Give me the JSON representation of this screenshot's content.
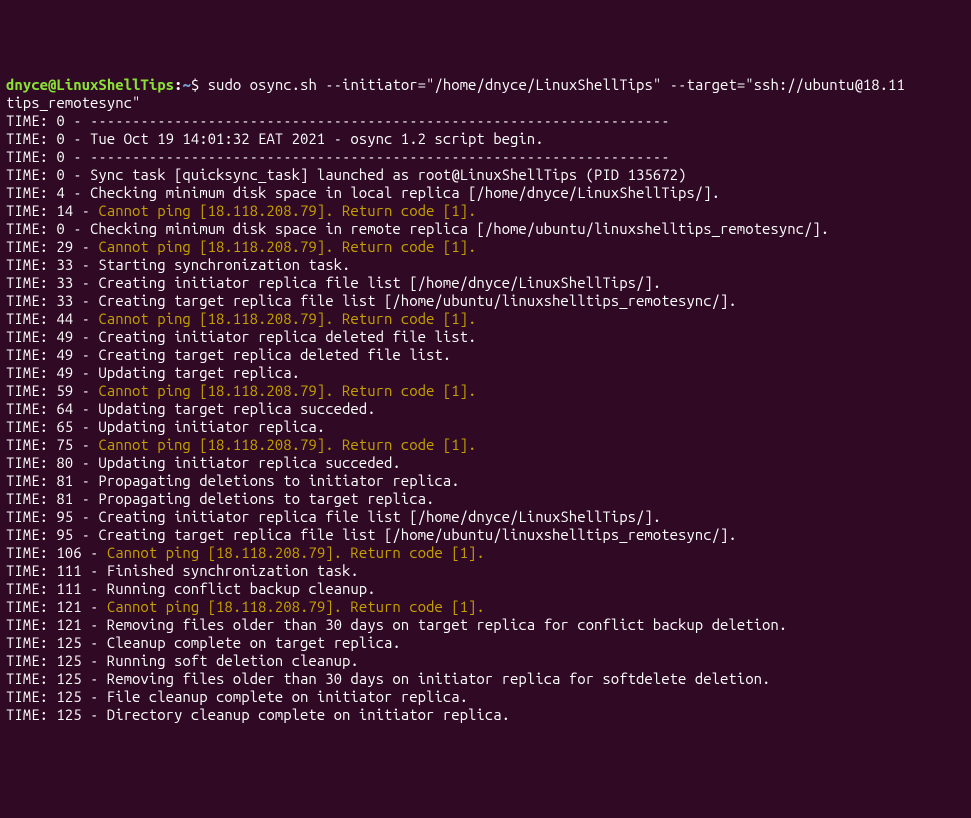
{
  "prompt": {
    "user": "dnyce",
    "at": "@",
    "host": "LinuxShellTips",
    "colon": ":",
    "path": "~",
    "dollar": "$ "
  },
  "command": {
    "line1": "sudo osync.sh --initiator=\"/home/dnyce/LinuxShellTips\" --target=\"ssh://ubuntu@18.11",
    "line2": "tips_remotesync\""
  },
  "lines": [
    {
      "prefix": "TIME: 0 - ",
      "text": "---------------------------------------------------------------------"
    },
    {
      "prefix": "TIME: 0 - ",
      "text": "Tue Oct 19 14:01:32 EAT 2021 - osync 1.2 script begin."
    },
    {
      "prefix": "TIME: 0 - ",
      "text": "---------------------------------------------------------------------"
    },
    {
      "prefix": "TIME: 0 - ",
      "text": "Sync task [quicksync_task] launched as root@LinuxShellTips (PID 135672)"
    },
    {
      "prefix": "TIME: 4 - ",
      "text": "Checking minimum disk space in local replica [/home/dnyce/LinuxShellTips/]."
    },
    {
      "prefix": "TIME: 14 - ",
      "warn": "Cannot ping [18.118.208.79]. Return code [1]."
    },
    {
      "prefix": "TIME: 0 - ",
      "text": "Checking minimum disk space in remote replica [/home/ubuntu/linuxshelltips_remotesync/]."
    },
    {
      "prefix": "TIME: 29 - ",
      "warn": "Cannot ping [18.118.208.79]. Return code [1]."
    },
    {
      "prefix": "TIME: 33 - ",
      "text": "Starting synchronization task."
    },
    {
      "prefix": "TIME: 33 - ",
      "text": "Creating initiator replica file list [/home/dnyce/LinuxShellTips/]."
    },
    {
      "prefix": "TIME: 33 - ",
      "text": "Creating target replica file list [/home/ubuntu/linuxshelltips_remotesync/]."
    },
    {
      "prefix": "TIME: 44 - ",
      "warn": "Cannot ping [18.118.208.79]. Return code [1]."
    },
    {
      "prefix": "TIME: 49 - ",
      "text": "Creating initiator replica deleted file list."
    },
    {
      "prefix": "TIME: 49 - ",
      "text": "Creating target replica deleted file list."
    },
    {
      "prefix": "TIME: 49 - ",
      "text": "Updating target replica."
    },
    {
      "prefix": "TIME: 59 - ",
      "warn": "Cannot ping [18.118.208.79]. Return code [1]."
    },
    {
      "prefix": "TIME: 64 - ",
      "text": "Updating target replica succeded."
    },
    {
      "prefix": "TIME: 65 - ",
      "text": "Updating initiator replica."
    },
    {
      "prefix": "TIME: 75 - ",
      "warn": "Cannot ping [18.118.208.79]. Return code [1]."
    },
    {
      "prefix": "TIME: 80 - ",
      "text": "Updating initiator replica succeded."
    },
    {
      "prefix": "TIME: 81 - ",
      "text": "Propagating deletions to initiator replica."
    },
    {
      "prefix": "TIME: 81 - ",
      "text": "Propagating deletions to target replica."
    },
    {
      "prefix": "TIME: 95 - ",
      "text": "Creating initiator replica file list [/home/dnyce/LinuxShellTips/]."
    },
    {
      "prefix": "TIME: 95 - ",
      "text": "Creating target replica file list [/home/ubuntu/linuxshelltips_remotesync/]."
    },
    {
      "prefix": "TIME: 106 - ",
      "warn": "Cannot ping [18.118.208.79]. Return code [1]."
    },
    {
      "prefix": "TIME: 111 - ",
      "text": "Finished synchronization task."
    },
    {
      "prefix": "TIME: 111 - ",
      "text": "Running conflict backup cleanup."
    },
    {
      "prefix": "TIME: 121 - ",
      "warn": "Cannot ping [18.118.208.79]. Return code [1]."
    },
    {
      "prefix": "TIME: 121 - ",
      "text": "Removing files older than 30 days on target replica for conflict backup deletion."
    },
    {
      "prefix": "TIME: 125 - ",
      "text": "Cleanup complete on target replica."
    },
    {
      "prefix": "TIME: 125 - ",
      "text": "Running soft deletion cleanup."
    },
    {
      "prefix": "TIME: 125 - ",
      "text": "Removing files older than 30 days on initiator replica for softdelete deletion."
    },
    {
      "prefix": "TIME: 125 - ",
      "text": "File cleanup complete on initiator replica."
    },
    {
      "prefix": "TIME: 125 - ",
      "text": "Directory cleanup complete on initiator replica."
    }
  ]
}
